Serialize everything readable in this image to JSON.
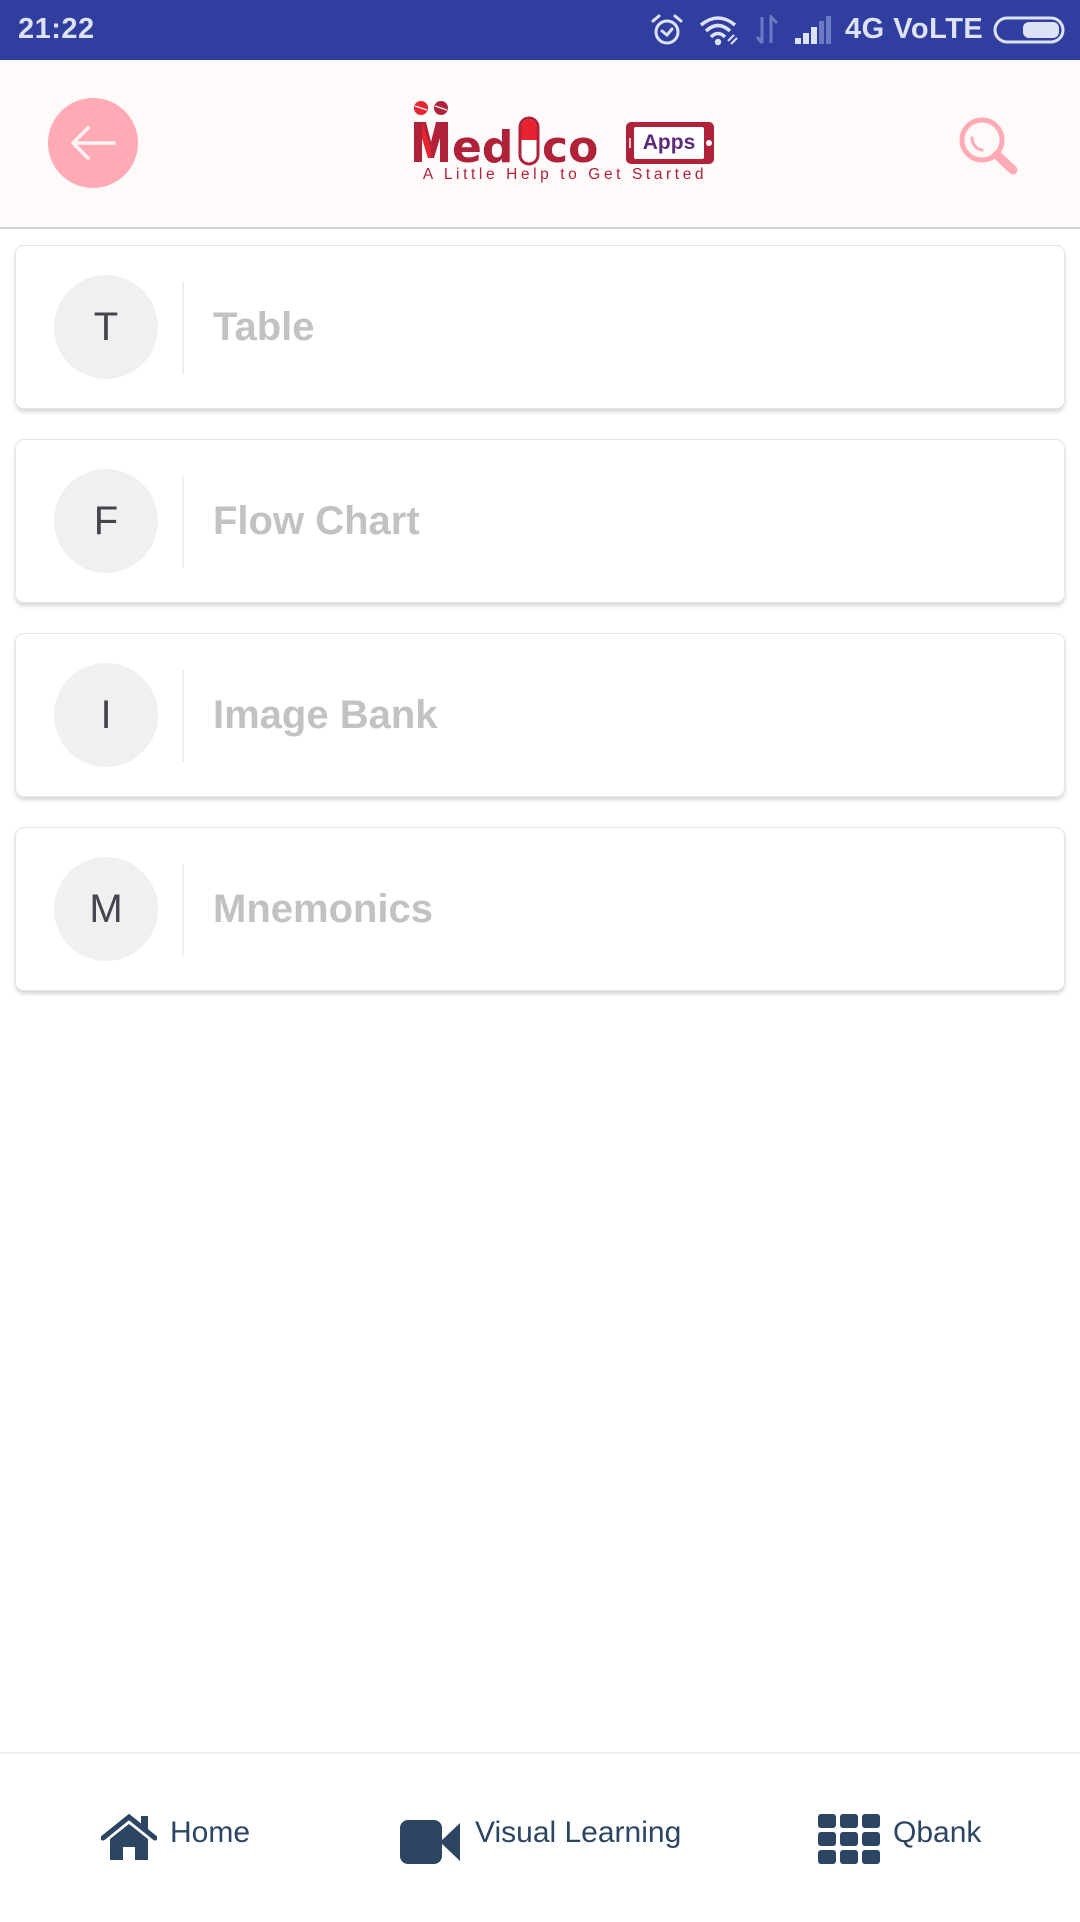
{
  "status_bar": {
    "time": "21:22",
    "network": "4G VoLTE",
    "icons": [
      "alarm-icon",
      "wifi-icon",
      "data-arrows-icon",
      "signal-icon",
      "battery-icon"
    ]
  },
  "header": {
    "back_icon": "arrow-left-icon",
    "logo": {
      "brand": "Medico",
      "badge": "Apps",
      "tagline": "A Little Help to Get Started"
    },
    "search_icon": "search-icon",
    "accent_color": "#FFAAB5"
  },
  "list": {
    "items": [
      {
        "initial": "T",
        "label": "Table"
      },
      {
        "initial": "F",
        "label": "Flow Chart"
      },
      {
        "initial": "I",
        "label": "Image Bank"
      },
      {
        "initial": "M",
        "label": "Mnemonics"
      }
    ]
  },
  "bottom_nav": {
    "items": [
      {
        "label": "Home",
        "icon": "home-icon"
      },
      {
        "label": "Visual Learning",
        "icon": "video-camera-icon"
      },
      {
        "label": "Qbank",
        "icon": "grid-icon"
      }
    ],
    "color": "#2B4563"
  }
}
